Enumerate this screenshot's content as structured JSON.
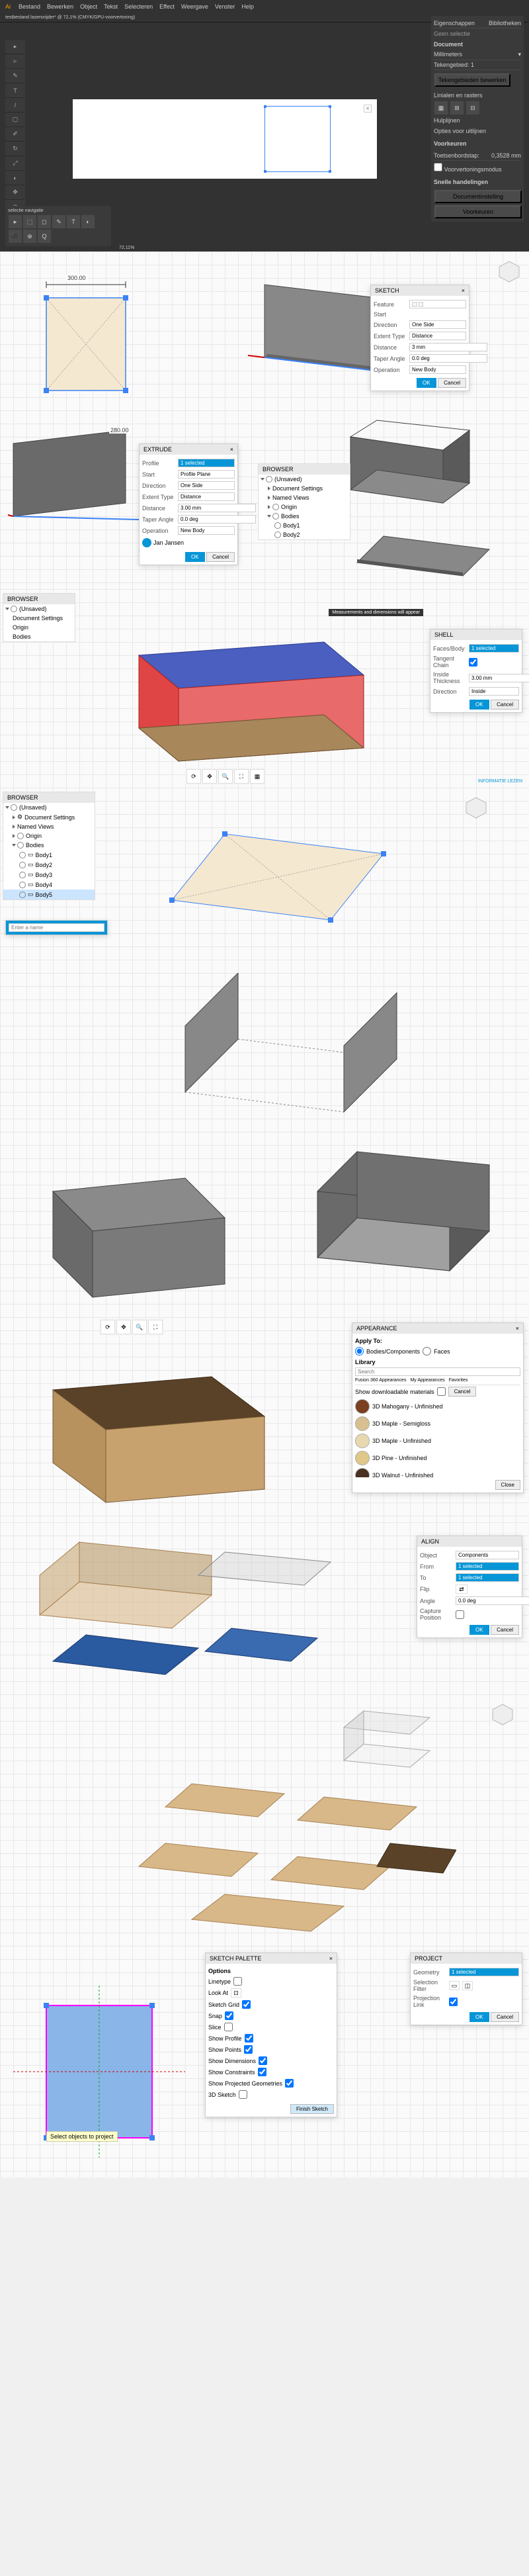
{
  "illustrator": {
    "menus": [
      "Bestand",
      "Bewerken",
      "Object",
      "Tekst",
      "Selecteren",
      "Effect",
      "Weergave",
      "Venster",
      "Help"
    ],
    "tab": "testbestand lasersnijder* @ 72,1% (CMYK/GPU-voorvertoning)",
    "zoom": "72,11%",
    "panel": {
      "title": "Eigenschappen",
      "tab2": "Bibliotheken",
      "section1": "Geen selectie",
      "section2": "Document",
      "units": "Millimeters",
      "artboard": "Tekengebied: 1",
      "edit_artboards": "Tekengebieden bewerken",
      "rulers_grid": "Linialen en rasters",
      "guides": "Hulplijnen",
      "snap_options": "Opties voor uitlijnen",
      "prefs": "Voorkeuren",
      "key_incr": "Toetsenbordstap:",
      "key_val": "0,3528 mm",
      "preview": "Voorvertoningsmodus",
      "quick_actions": "Snelle handelingen",
      "doc_setup": "Documentinstelling",
      "more": "Voorkeuren"
    },
    "tools": [
      "▸",
      "⬚",
      "✎",
      "T",
      "/",
      "◻",
      "✂",
      "↻",
      "⟲",
      "◐",
      "⬛",
      "◧",
      "✥",
      "⊕",
      "Q",
      "⬚"
    ],
    "bottom_label": "selectie    navigatie"
  },
  "fusion1": {
    "dim": "300.00",
    "sketch_panel": {
      "title": "SKETCH",
      "feature": "Feature",
      "start": "Start",
      "direction": "Direction",
      "direction_val": "One Side",
      "extent": "Extent Type",
      "extent_val": "Distance",
      "distance": "Distance",
      "distance_val": "3 mm",
      "taper": "Taper Angle",
      "taper_val": "0.0 deg",
      "operation": "Operation",
      "operation_val": "New Body",
      "ok": "OK",
      "cancel": "Cancel"
    },
    "extrude_panel": {
      "title": "EXTRUDE",
      "profile": "Profile",
      "profile_val": "1 selected",
      "start": "Start",
      "start_val": "Profile Plane",
      "direction": "Direction",
      "direction_val": "One Side",
      "extent": "Extent Type",
      "extent_val": "Distance",
      "distance": "Distance",
      "distance_val": "3.00 mm",
      "taper": "Taper Angle",
      "taper_val": "0.0 deg",
      "operation": "Operation",
      "operation_val": "New Body",
      "ok": "OK",
      "cancel": "Cancel"
    },
    "comment_user": "Jan Jansen",
    "browser": {
      "title": "BROWSER",
      "items": [
        "(Unsaved)",
        "Document Settings",
        "Named Views",
        "Origin",
        "Bodies",
        "Body1",
        "Body2"
      ]
    },
    "dim2": "280.00"
  },
  "fusion2": {
    "panel_title": "Measurements and dimensions will appear",
    "shell_panel": {
      "title": "SHELL",
      "faces": "Faces/Body",
      "faces_val": "1 selected",
      "tangent": "Tangent Chain",
      "inside": "Inside Thickness",
      "inside_val": "3.00 mm",
      "direction": "Direction",
      "direction_val": "Inside",
      "ok": "OK",
      "cancel": "Cancel"
    },
    "info": "INFORMATIE LEZEN"
  },
  "fusion3": {
    "browser": {
      "title": "BROWSER",
      "items": [
        "(Unsaved)",
        "Document Settings",
        "Named Views",
        "Origin",
        "Bodies",
        "Body1",
        "Body2",
        "Body3",
        "Body4",
        "Body5"
      ]
    },
    "rename": "Enter a name"
  },
  "appearance": {
    "title": "APPEARANCE",
    "apply_to": "Apply To:",
    "bodies": "Bodies/Components",
    "faces": "Faces",
    "search": "Search",
    "library": "Library",
    "tabs": [
      "Fusion 360 Appearances",
      "My Appearances",
      "Favorites"
    ],
    "show_dl": "Show downloadable materials",
    "cancel": "Cancel",
    "materials": [
      "3D Mahogany - Unfinished",
      "3D Maple - Semigloss",
      "3D Maple - Unfinished",
      "3D Pine - Unfinished",
      "3D Walnut - Unfinished"
    ],
    "close": "Close"
  },
  "align": {
    "title": "ALIGN",
    "object": "Object",
    "object_val": "Components",
    "from": "From",
    "from_val": "1 selected",
    "to": "To",
    "to_val": "1 selected",
    "flip": "Flip",
    "angle": "Angle",
    "angle_val": "0.0 deg",
    "capture": "Capture Position",
    "ok": "OK",
    "cancel": "Cancel"
  },
  "sketch_palette": {
    "title": "SKETCH PALETTE",
    "options": "Options",
    "items": [
      "Linetype",
      "Look At",
      "Sketch Grid",
      "Snap",
      "Slice",
      "Show Profile",
      "Show Points",
      "Show Dimensions",
      "Show Constraints",
      "Show Projected Geometries",
      "3D Sketch"
    ],
    "finish": "Finish Sketch"
  },
  "project": {
    "title": "PROJECT",
    "geometry": "Geometry",
    "geometry_val": "1 selected",
    "filter": "Selection Filter",
    "proj_link": "Projection Link",
    "ok": "OK",
    "cancel": "Cancel"
  },
  "tooltip": "Select objects to project"
}
